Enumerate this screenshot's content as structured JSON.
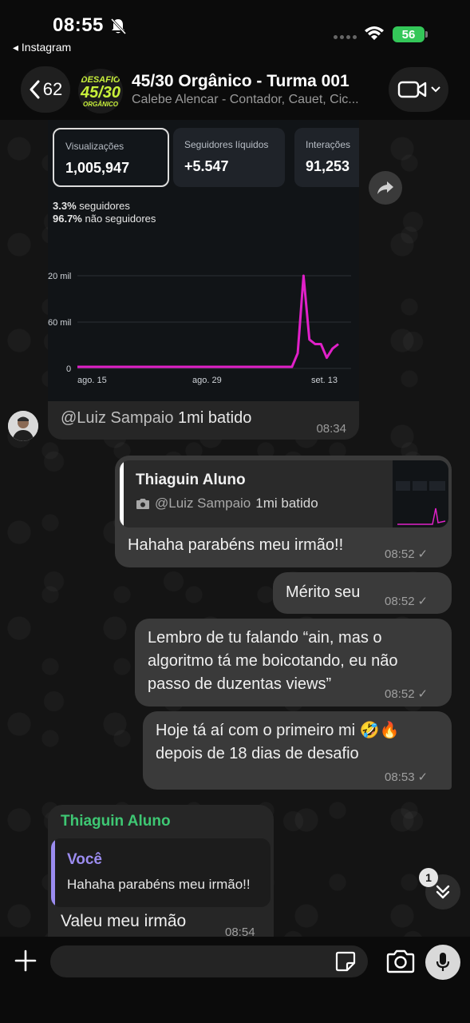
{
  "status_bar": {
    "time": "08:55",
    "back_app": "◂ Instagram",
    "battery": "56"
  },
  "header": {
    "back_count": "62",
    "group_avatar": {
      "line1": "DESAFIO",
      "line2": "45/30",
      "line3": "ORGÂNICO"
    },
    "title": "45/30 Orgânico - Turma 001",
    "subtitle": "Calebe Alencar - Contador, Cauet, Cic..."
  },
  "image_message": {
    "cards": [
      {
        "label": "Visualizações",
        "value": "1,005,947"
      },
      {
        "label": "Seguidores líquidos",
        "value": "+5.547"
      },
      {
        "label": "Interações",
        "value": "91,253"
      }
    ],
    "followers_pct": "3.3%",
    "followers_label": " seguidores",
    "nonfollowers_pct": "96.7%",
    "nonfollowers_label": " não seguidores",
    "caption_mention": "@Luiz Sampaio",
    "caption_text": " 1mi batido",
    "time": "08:34"
  },
  "chart_data": {
    "type": "line",
    "title": "",
    "xlabel": "",
    "ylabel": "",
    "y_tick_labels": [
      "20 mil",
      "60 mil",
      "0"
    ],
    "x_tick_labels": [
      "ago. 15",
      "ago. 29",
      "set. 13"
    ],
    "series": [
      {
        "color": "#e020c8",
        "values": [
          0,
          0,
          0,
          0,
          0,
          0,
          0,
          0,
          0,
          0,
          0,
          0,
          0,
          0,
          0,
          0,
          0,
          0,
          0,
          0,
          0,
          0,
          0,
          0,
          0,
          0,
          0,
          0,
          0,
          0,
          0,
          0,
          0,
          0,
          0,
          0,
          0,
          0,
          3,
          20,
          6,
          5,
          5,
          2,
          4,
          5
        ]
      }
    ]
  },
  "messages": [
    {
      "reply_to_name": "Thiaguin Aluno",
      "reply_to_mention": "@Luiz Sampaio",
      "reply_to_text": " 1mi batido",
      "text": "Hahaha parabéns meu irmão!!",
      "time": "08:52"
    },
    {
      "text": "Mérito seu",
      "time": "08:52"
    },
    {
      "line1": "Lembro de tu falando “ain, mas o",
      "line2": "algoritmo tá me boicotando, eu não",
      "line3": "passo de duzentas views”",
      "time": "08:52"
    },
    {
      "line1": "Hoje tá aí com o primeiro mi 🤣🔥",
      "line2": "depois de 18 dias de desafio",
      "time": "08:53"
    }
  ],
  "incoming": {
    "sender": "Thiaguin Aluno",
    "quote_name": "Você",
    "quote_text": "Hahaha parabéns meu irmão!!",
    "text": "Valeu meu irmão",
    "time": "08:54"
  },
  "unread_count": "1",
  "check_mark": "✓",
  "input": {
    "placeholder": ""
  }
}
